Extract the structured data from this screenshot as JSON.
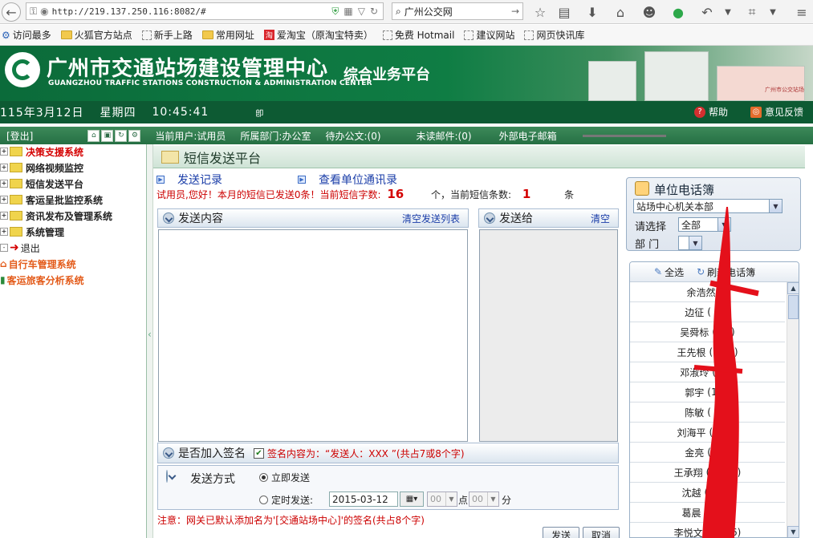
{
  "browser": {
    "url": "http://219.137.250.116:8082/#",
    "search_text": "广州公交网"
  },
  "bookmarks": [
    {
      "label": "访问最多",
      "icon": "gear-icon"
    },
    {
      "label": "火狐官方站点",
      "icon": "folder-icon"
    },
    {
      "label": "新手上路",
      "icon": "page-icon"
    },
    {
      "label": "常用网址",
      "icon": "folder-icon"
    },
    {
      "label": "爱淘宝（原淘宝特卖）",
      "icon": "taobao-icon"
    },
    {
      "label": "免费 Hotmail",
      "icon": "page-icon"
    },
    {
      "label": "建议网站",
      "icon": "page-icon"
    },
    {
      "label": "网页快讯库",
      "icon": "page-icon"
    }
  ],
  "banner": {
    "title": "广州市交通站场建设管理中心",
    "subtitle": "GUANGZHOU TRAFFIC STATIONS CONSTRUCTION & ADMINISTRATION CENTER",
    "platform": "综合业务平台",
    "building_sign": "广州市公交站场"
  },
  "datebar": {
    "date": "115年3月12日",
    "weekday": "星期四",
    "time": "10:45:41",
    "mark": "卽",
    "help": "帮助",
    "feedback": "意见反馈"
  },
  "status": {
    "logout": "[登出]",
    "current_user": "当前用户:试用员",
    "department": "所属部门:办公室",
    "pending_docs": "待办公文:(0)",
    "unread_mail": "未读邮件:(0)",
    "external_mail": "外部电子邮箱"
  },
  "sidebar": {
    "items": [
      {
        "label": "决策支援系统",
        "style": "red"
      },
      {
        "label": "网络视频监控",
        "style": "black"
      },
      {
        "label": "短信发送平台",
        "style": "black"
      },
      {
        "label": "客运呈批监控系统",
        "style": "black"
      },
      {
        "label": "资讯发布及管理系统",
        "style": "black"
      },
      {
        "label": "系统管理",
        "style": "black"
      }
    ],
    "exit": "退出",
    "bike_system": "自行车管理系统",
    "passenger_system": "客运旅客分析系统"
  },
  "main": {
    "title": "短信发送平台",
    "send_record": "发送记录",
    "view_directory": "查看单位通讯录",
    "quota_text": "试用员,您好！本月的短信已发送0条！当前短信字数:",
    "char_count": "16",
    "count_unit": "个，当前短信条数:",
    "msg_count": "1",
    "msg_unit": "条",
    "content_panel": {
      "title": "发送内容",
      "action": "清空发送列表"
    },
    "recipient_panel": {
      "title": "发送给",
      "action": "清空"
    },
    "signature": {
      "title": "是否加入签名",
      "checked": true,
      "content": "签名内容为：“发送人：XXX ”(共占7或8个字)"
    },
    "send_mode": {
      "title": "发送方式",
      "immediate": "立即发送",
      "scheduled": "定时发送:",
      "date": "2015-03-12",
      "hour": "00",
      "hour_unit": "点",
      "minute": "00",
      "minute_unit": "分"
    },
    "note": "注意：网关已默认添加名为'[交通站场中心]'的签名(共占8个字)",
    "send_button": "发送",
    "cancel_button": "取消"
  },
  "phonebook": {
    "title": "单位电话簿",
    "unit": "站场中心机关本部",
    "choose_label": "请选择",
    "choose_value": "全部",
    "dept_label": "部 门",
    "select_all": "全选",
    "refresh": "刷新电话簿",
    "contacts": [
      {
        "name": "余浩然",
        "phone": "（"
      },
      {
        "name": "边征",
        "phone": "(           39)"
      },
      {
        "name": "吴舜标",
        "phone": "(           59)"
      },
      {
        "name": "王先根",
        "phone": "(          560)"
      },
      {
        "name": "邓淑玲",
        "phone": "(           76)"
      },
      {
        "name": "郭宇",
        "phone": "(1           1)"
      },
      {
        "name": "陈敏",
        "phone": "(           76)"
      },
      {
        "name": "刘海平",
        "phone": "(          851)"
      },
      {
        "name": "金亮",
        "phone": "(           48)"
      },
      {
        "name": "王承翔",
        "phone": "(         9666)"
      },
      {
        "name": "沈越",
        "phone": "(          663)"
      },
      {
        "name": "葛晨",
        "phone": "(          786)"
      },
      {
        "name": "李悦文",
        "phone": "(         3736)"
      }
    ]
  },
  "colors": {
    "brand_green": "#0f7d44",
    "alert_red": "#d40000",
    "link_blue": "#1a3da8"
  }
}
